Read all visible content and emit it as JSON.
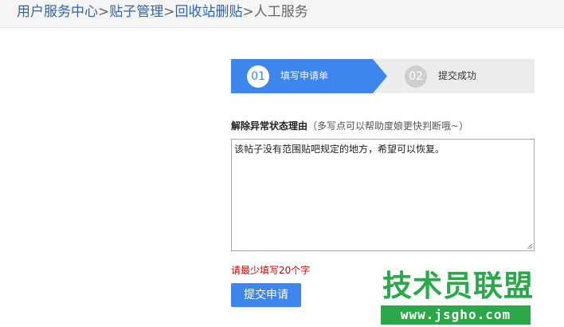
{
  "breadcrumb": {
    "items": [
      "用户服务中心",
      "贴子管理",
      "回收站删贴"
    ],
    "separator": ">",
    "current": "人工服务"
  },
  "steps": [
    {
      "number": "01",
      "label": "填写申请单",
      "active": true
    },
    {
      "number": "02",
      "label": "提交成功",
      "active": false
    }
  ],
  "form": {
    "reason_label": "解除异常状态理由",
    "reason_hint": "（多写点可以帮助度娘更快判断哦~）",
    "reason_value": "该帖子没有范围贴吧规定的地方，希望可以恢复。",
    "error": "请最少填写20个字",
    "submit_label": "提交申请"
  },
  "watermark": {
    "title": "技术员联盟",
    "url": "www.jsgho.com"
  },
  "colors": {
    "accent": "#3c86ee",
    "link": "#2d64b3",
    "error": "#d20000",
    "watermark": "#2aa84a"
  }
}
